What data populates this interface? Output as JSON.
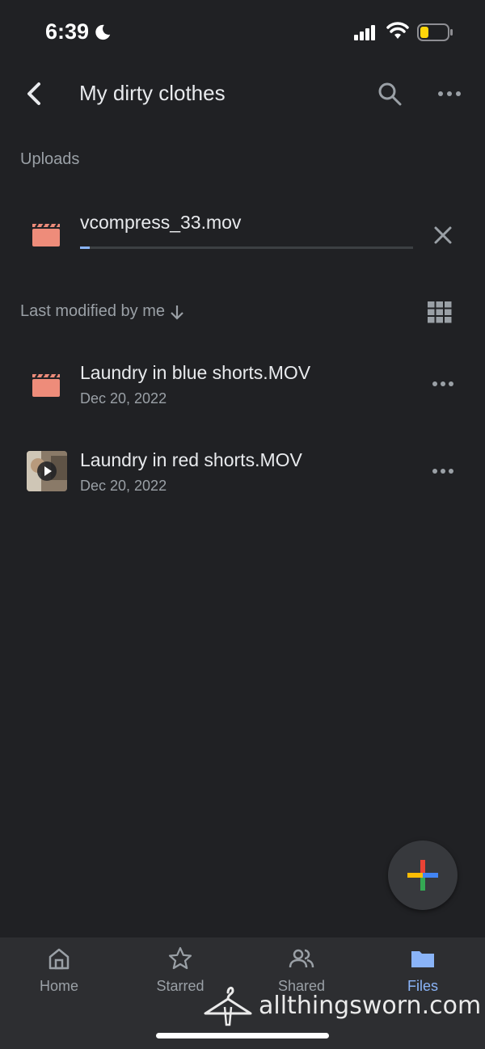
{
  "status_bar": {
    "time": "6:39"
  },
  "app_bar": {
    "title": "My dirty clothes"
  },
  "uploads": {
    "label": "Uploads",
    "item": {
      "name": "vcompress_33.mov",
      "progress": 0.03
    }
  },
  "sort": {
    "label": "Last modified by me"
  },
  "files": [
    {
      "name": "Laundry in blue shorts.MOV",
      "date": "Dec 20, 2022"
    },
    {
      "name": "Laundry in red shorts.MOV",
      "date": "Dec 20, 2022"
    }
  ],
  "nav": [
    {
      "label": "Home",
      "icon": "home-icon"
    },
    {
      "label": "Starred",
      "icon": "star-icon"
    },
    {
      "label": "Shared",
      "icon": "people-icon"
    },
    {
      "label": "Files",
      "icon": "folder-icon",
      "active": true
    }
  ],
  "watermark": {
    "text": "allthingsworn.com"
  },
  "colors": {
    "background": "#202124",
    "accent": "#8ab4f8",
    "video_icon": "#ee8c7a",
    "nav_bg": "#2d2e31"
  }
}
